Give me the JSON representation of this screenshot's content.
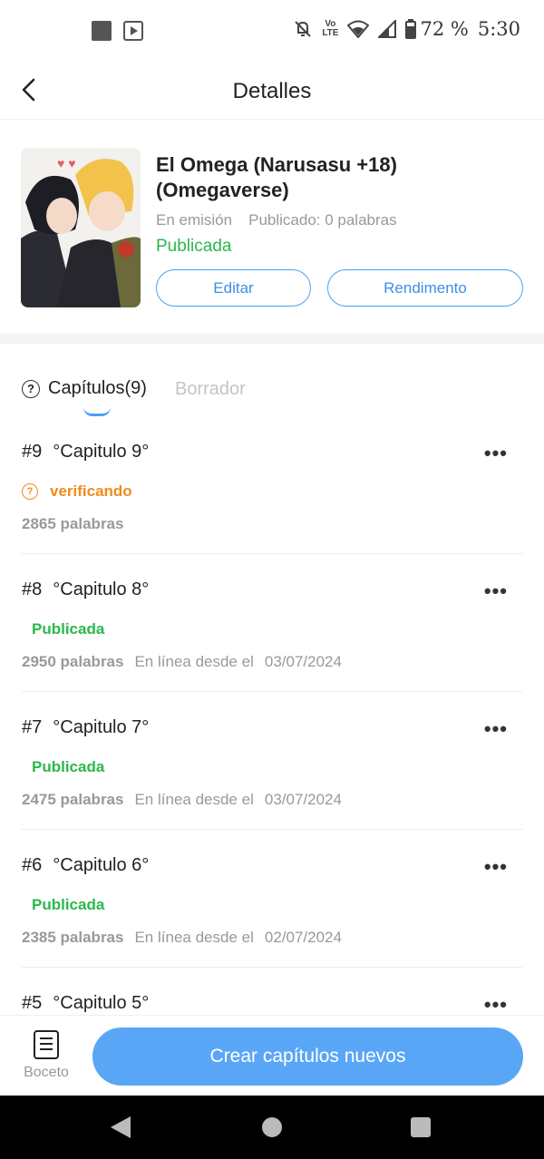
{
  "status_bar": {
    "battery": "72 %",
    "time": "5:30",
    "network": "LTE"
  },
  "header": {
    "title": "Detalles"
  },
  "book": {
    "title": "El Omega (Narusasu +18) (Omegaverse)",
    "status": "En emisión",
    "published_words": "Publicado: 0 palabras",
    "publication_state": "Publicada",
    "edit_label": "Editar",
    "performance_label": "Rendimento"
  },
  "tabs": {
    "chapters": "Capítulos(9)",
    "draft": "Borrador"
  },
  "chapters": [
    {
      "number": "#9",
      "title": "°Capitulo 9°",
      "status": "verificando",
      "words": "2865 palabras",
      "online_label": "",
      "date": ""
    },
    {
      "number": "#8",
      "title": "°Capitulo 8°",
      "status": "Publicada",
      "words": "2950 palabras",
      "online_label": "En línea desde el",
      "date": "03/07/2024"
    },
    {
      "number": "#7",
      "title": "°Capitulo 7°",
      "status": "Publicada",
      "words": "2475 palabras",
      "online_label": "En línea desde el",
      "date": "03/07/2024"
    },
    {
      "number": "#6",
      "title": "°Capitulo 6°",
      "status": "Publicada",
      "words": "2385 palabras",
      "online_label": "En línea desde el",
      "date": "02/07/2024"
    },
    {
      "number": "#5",
      "title": "°Capitulo 5°",
      "status": "",
      "words": "",
      "online_label": "",
      "date": ""
    }
  ],
  "more_glyph": "•••",
  "bottom": {
    "draft_label": "Boceto",
    "create_label": "Crear capítulos nuevos"
  },
  "colors": {
    "accent": "#5aa6f6",
    "published": "#2bb84a",
    "verifying": "#f08a1c"
  }
}
